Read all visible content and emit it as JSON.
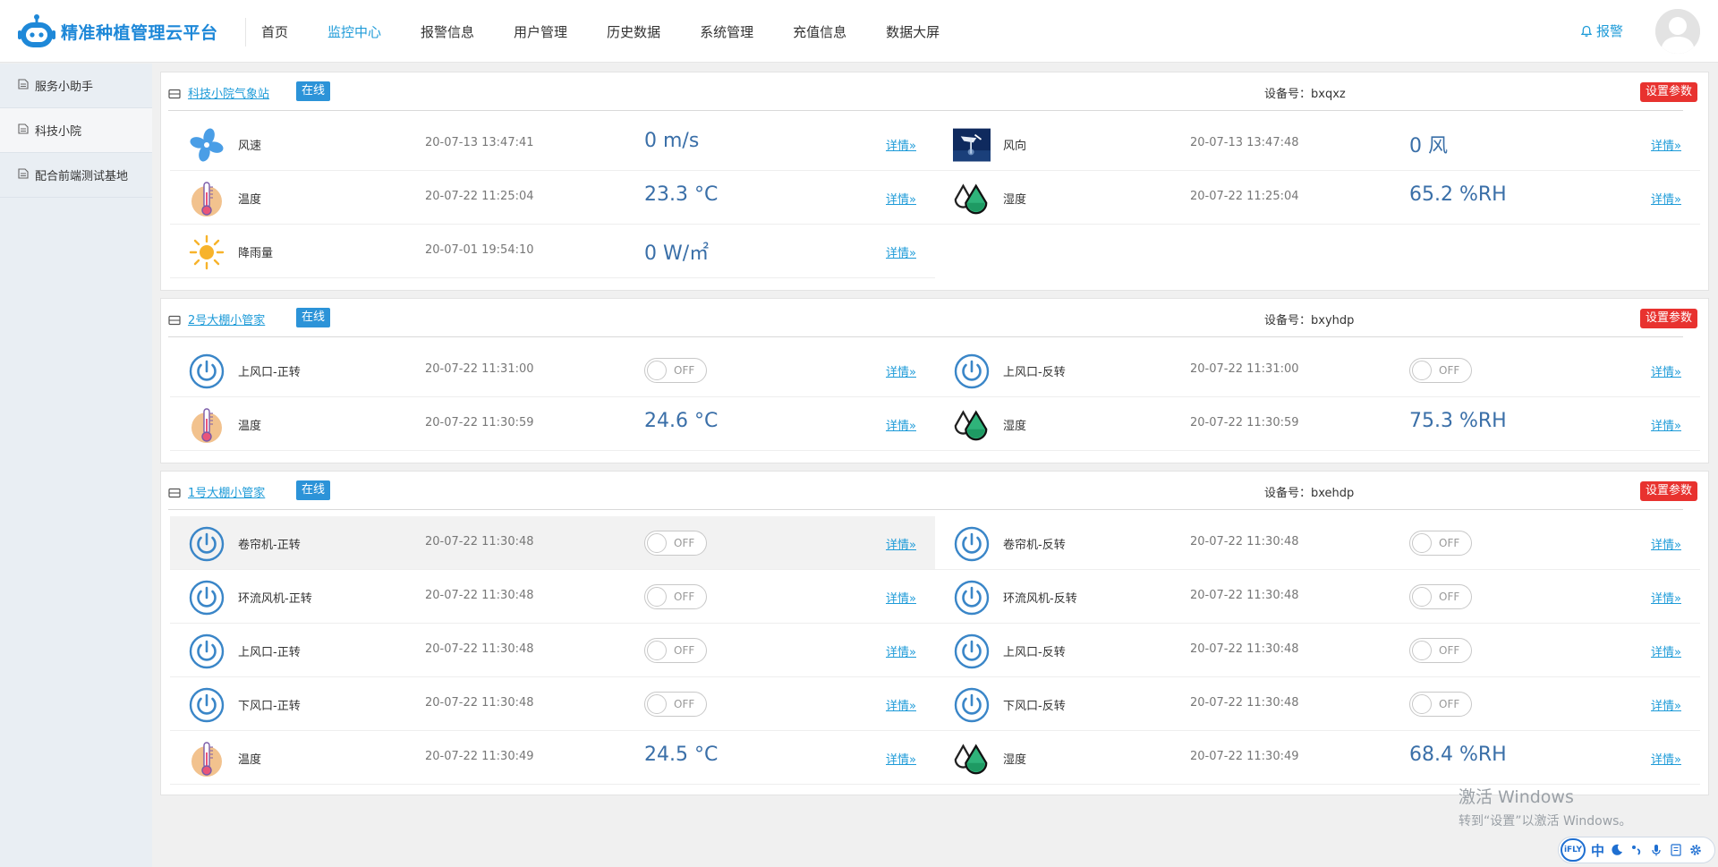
{
  "app": {
    "title": "精准种植管理云平台"
  },
  "nav": [
    {
      "label": "首页",
      "active": false
    },
    {
      "label": "监控中心",
      "active": true
    },
    {
      "label": "报警信息",
      "active": false
    },
    {
      "label": "用户管理",
      "active": false
    },
    {
      "label": "历史数据",
      "active": false
    },
    {
      "label": "系统管理",
      "active": false
    },
    {
      "label": "充值信息",
      "active": false
    },
    {
      "label": "数据大屏",
      "active": false
    }
  ],
  "header": {
    "alarm_label": "报警"
  },
  "sidebar": {
    "items": [
      {
        "label": "服务小助手",
        "active": false
      },
      {
        "label": "科技小院",
        "active": true
      },
      {
        "label": "配合前端测试基地",
        "active": false
      }
    ]
  },
  "common": {
    "online_label": "在线",
    "set_params_label": "设置参数",
    "detail_label": "详情",
    "off_label": "OFF"
  },
  "panels": [
    {
      "title": "科技小院气象站",
      "device_no": "设备号：bxqxz",
      "rows": [
        [
          {
            "icon": "wind-speed-icon",
            "name": "风速",
            "time": "20-07-13 13:47:41",
            "value": "0 m/s"
          },
          {
            "icon": "wind-direction-icon",
            "name": "风向",
            "time": "20-07-13 13:47:48",
            "value": "0 风"
          }
        ],
        [
          {
            "icon": "thermometer-icon",
            "name": "温度",
            "time": "20-07-22 11:25:04",
            "value": "23.3 °C"
          },
          {
            "icon": "humidity-icon",
            "name": "湿度",
            "time": "20-07-22 11:25:04",
            "value": "65.2 %RH"
          }
        ],
        [
          {
            "icon": "sun-icon",
            "name": "降雨量",
            "time": "20-07-01 19:54:10",
            "value": "0 W/㎡"
          }
        ]
      ]
    },
    {
      "title": "2号大棚小管家",
      "device_no": "设备号：bxyhdp",
      "rows": [
        [
          {
            "icon": "power-icon",
            "name": "上风口-正转",
            "time": "20-07-22 11:31:00",
            "switch": true
          },
          {
            "icon": "power-icon",
            "name": "上风口-反转",
            "time": "20-07-22 11:31:00",
            "switch": true
          }
        ],
        [
          {
            "icon": "thermometer-icon",
            "name": "温度",
            "time": "20-07-22 11:30:59",
            "value": "24.6 °C"
          },
          {
            "icon": "humidity-icon",
            "name": "湿度",
            "time": "20-07-22 11:30:59",
            "value": "75.3 %RH"
          }
        ]
      ]
    },
    {
      "title": "1号大棚小管家",
      "device_no": "设备号：bxehdp",
      "rows": [
        [
          {
            "icon": "power-icon",
            "name": "卷帘机-正转",
            "time": "20-07-22 11:30:48",
            "switch": true,
            "highlight": true
          },
          {
            "icon": "power-icon",
            "name": "卷帘机-反转",
            "time": "20-07-22 11:30:48",
            "switch": true
          }
        ],
        [
          {
            "icon": "power-icon",
            "name": "环流风机-正转",
            "time": "20-07-22 11:30:48",
            "switch": true
          },
          {
            "icon": "power-icon",
            "name": "环流风机-反转",
            "time": "20-07-22 11:30:48",
            "switch": true
          }
        ],
        [
          {
            "icon": "power-icon",
            "name": "上风口-正转",
            "time": "20-07-22 11:30:48",
            "switch": true
          },
          {
            "icon": "power-icon",
            "name": "上风口-反转",
            "time": "20-07-22 11:30:48",
            "switch": true
          }
        ],
        [
          {
            "icon": "power-icon",
            "name": "下风口-正转",
            "time": "20-07-22 11:30:48",
            "switch": true
          },
          {
            "icon": "power-icon",
            "name": "下风口-反转",
            "time": "20-07-22 11:30:48",
            "switch": true
          }
        ],
        [
          {
            "icon": "thermometer-icon",
            "name": "温度",
            "time": "20-07-22 11:30:49",
            "value": "24.5 °C"
          },
          {
            "icon": "humidity-icon",
            "name": "湿度",
            "time": "20-07-22 11:30:49",
            "value": "68.4 %RH"
          }
        ]
      ]
    }
  ],
  "watermark": {
    "line1": "激活 Windows",
    "line2": "转到“设置”以激活 Windows。"
  },
  "ime": {
    "logo": "iFLY",
    "mode": "中"
  },
  "colors": {
    "accent": "#1e9bd8",
    "online": "#2c93d8",
    "danger": "#e8322f",
    "value": "#3a6fa8"
  }
}
